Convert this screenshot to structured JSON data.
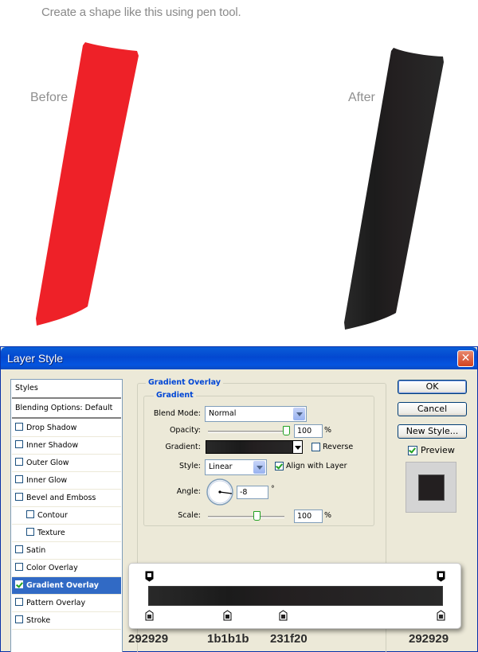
{
  "instruction": "Create a shape like this using pen tool.",
  "labels": {
    "before": "Before",
    "after": "After"
  },
  "colors": {
    "before_shape": "#ee2128",
    "after_shape": "#231f20"
  },
  "dialog": {
    "title": "Layer Style",
    "close_icon": "close-icon",
    "styles_header": "Styles",
    "blending_options": "Blending Options: Default",
    "effects": [
      {
        "label": "Drop Shadow",
        "checked": false
      },
      {
        "label": "Inner Shadow",
        "checked": false
      },
      {
        "label": "Outer Glow",
        "checked": false
      },
      {
        "label": "Inner Glow",
        "checked": false
      },
      {
        "label": "Bevel and Emboss",
        "checked": false
      },
      {
        "label": "Contour",
        "checked": false
      },
      {
        "label": "Texture",
        "checked": false
      },
      {
        "label": "Satin",
        "checked": false
      },
      {
        "label": "Color Overlay",
        "checked": false
      },
      {
        "label": "Gradient Overlay",
        "checked": true
      },
      {
        "label": "Pattern Overlay",
        "checked": false
      },
      {
        "label": "Stroke",
        "checked": false
      }
    ],
    "panel": {
      "outer_title": "Gradient Overlay",
      "inner_title": "Gradient",
      "blend_mode_label": "Blend Mode:",
      "blend_mode_value": "Normal",
      "opacity_label": "Opacity:",
      "opacity_value": "100",
      "percent": "%",
      "gradient_label": "Gradient:",
      "reverse_label": "Reverse",
      "reverse_checked": false,
      "style_label": "Style:",
      "style_value": "Linear",
      "align_label": "Align with Layer",
      "align_checked": true,
      "angle_label": "Angle:",
      "angle_value": "-8",
      "degree": "°",
      "scale_label": "Scale:",
      "scale_value": "100"
    },
    "buttons": {
      "ok": "OK",
      "cancel": "Cancel",
      "new_style": "New Style..."
    },
    "preview_label": "Preview",
    "preview_checked": true
  },
  "gradient_stops": [
    "292929",
    "1b1b1b",
    "231f20",
    "292929"
  ]
}
